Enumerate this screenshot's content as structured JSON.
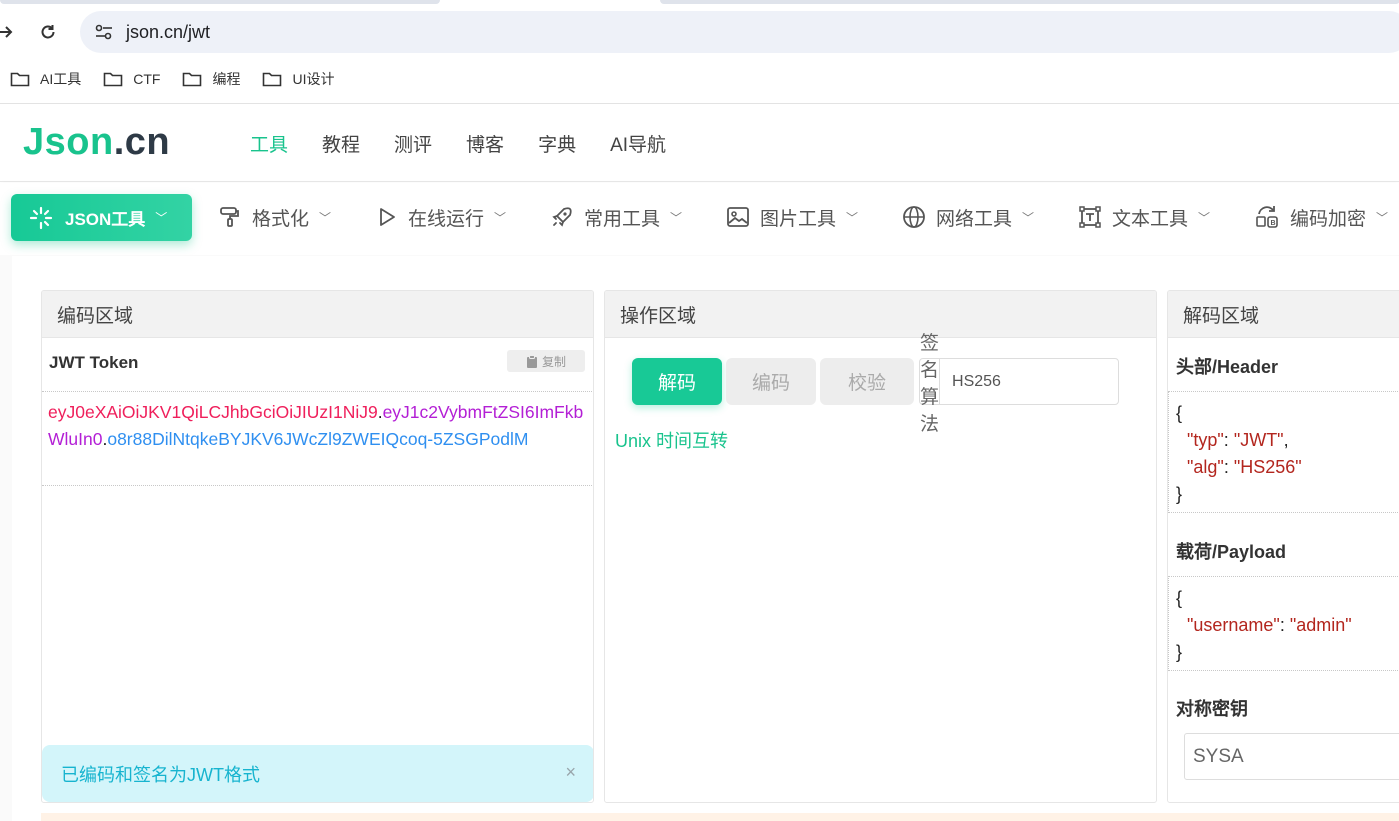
{
  "browser": {
    "url": "json.cn/jwt",
    "bookmarks": [
      "AI工具",
      "CTF",
      "编程",
      "UI设计"
    ]
  },
  "header": {
    "logo_main": "Json",
    "logo_suffix": ".cn",
    "nav": [
      "工具",
      "教程",
      "测评",
      "博客",
      "字典",
      "AI导航"
    ],
    "accent": "#19c38d"
  },
  "toolbar": {
    "primary": "JSON工具",
    "items": [
      "格式化",
      "在线运行",
      "常用工具",
      "图片工具",
      "网络工具",
      "文本工具",
      "编码加密"
    ]
  },
  "encode_panel": {
    "title": "编码区域",
    "label": "JWT Token",
    "copy": "复制",
    "token_header": "eyJ0eXAiOiJKV1QiLCJhbGciOiJIUzI1NiJ9",
    "token_payload": "eyJ1c2VybmFtZSI6ImFkbWluIn0",
    "token_signature": "o8r88DilNtqkeBYJKV6JWcZl9ZWEIQcoq-5ZSGPodlM",
    "dot": ".",
    "alert": "已编码和签名为JWT格式",
    "alert_close": "×"
  },
  "op_panel": {
    "title": "操作区域",
    "decode": "解码",
    "encode": "编码",
    "verify": "校验",
    "algo_label": "签名算法",
    "algo_value": "HS256",
    "unix_link": "Unix 时间互转"
  },
  "decode_panel": {
    "title": "解码区域",
    "header_label": "头部/Header",
    "header_json": {
      "open": "{",
      "close": "}",
      "k1": "\"typ\"",
      "v1": "\"JWT\"",
      "k2": "\"alg\"",
      "v2": "\"HS256\"",
      "colon": ": ",
      "comma": ","
    },
    "payload_label": "载荷/Payload",
    "payload_json": {
      "open": "{",
      "close": "}",
      "k1": "\"username\"",
      "v1": "\"admin\""
    },
    "secret_label": "对称密钥",
    "secret_value": "SYSA"
  }
}
